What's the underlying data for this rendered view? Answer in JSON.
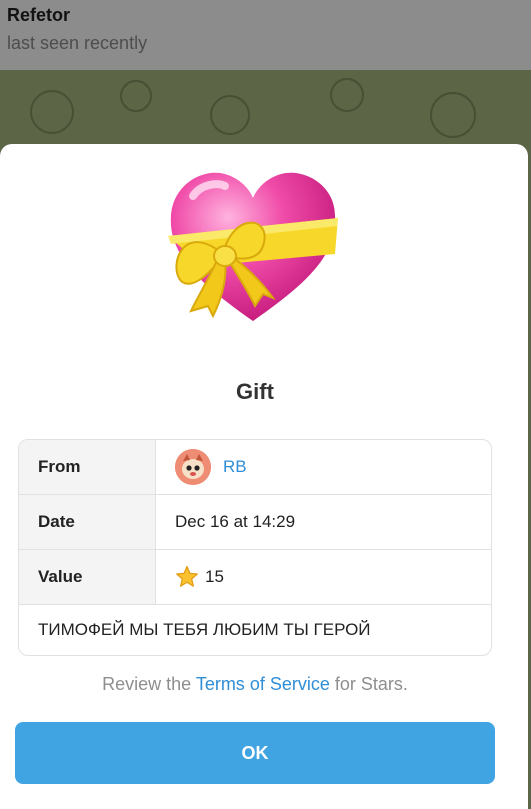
{
  "chat": {
    "title": "Refetor",
    "status": "last seen recently"
  },
  "gift": {
    "title": "Gift",
    "sticker": "heart-with-ribbon-icon",
    "rows": {
      "from_label": "From",
      "from_value": "RB",
      "date_label": "Date",
      "date_value": "Dec 16 at 14:29",
      "value_label": "Value",
      "value_amount": "15",
      "value_icon": "star-icon"
    },
    "message": "ТИМОФЕЙ МЫ ТЕБЯ ЛЮБИМ ТЫ ГЕРОЙ"
  },
  "terms": {
    "prefix": "Review the",
    "link": "Terms of Service",
    "suffix": "for Stars."
  },
  "ok_label": "OK",
  "colors": {
    "accent": "#40a3e2",
    "link": "#2f8ed6",
    "heart": "#e8439a",
    "ribbon": "#f7d82a"
  }
}
